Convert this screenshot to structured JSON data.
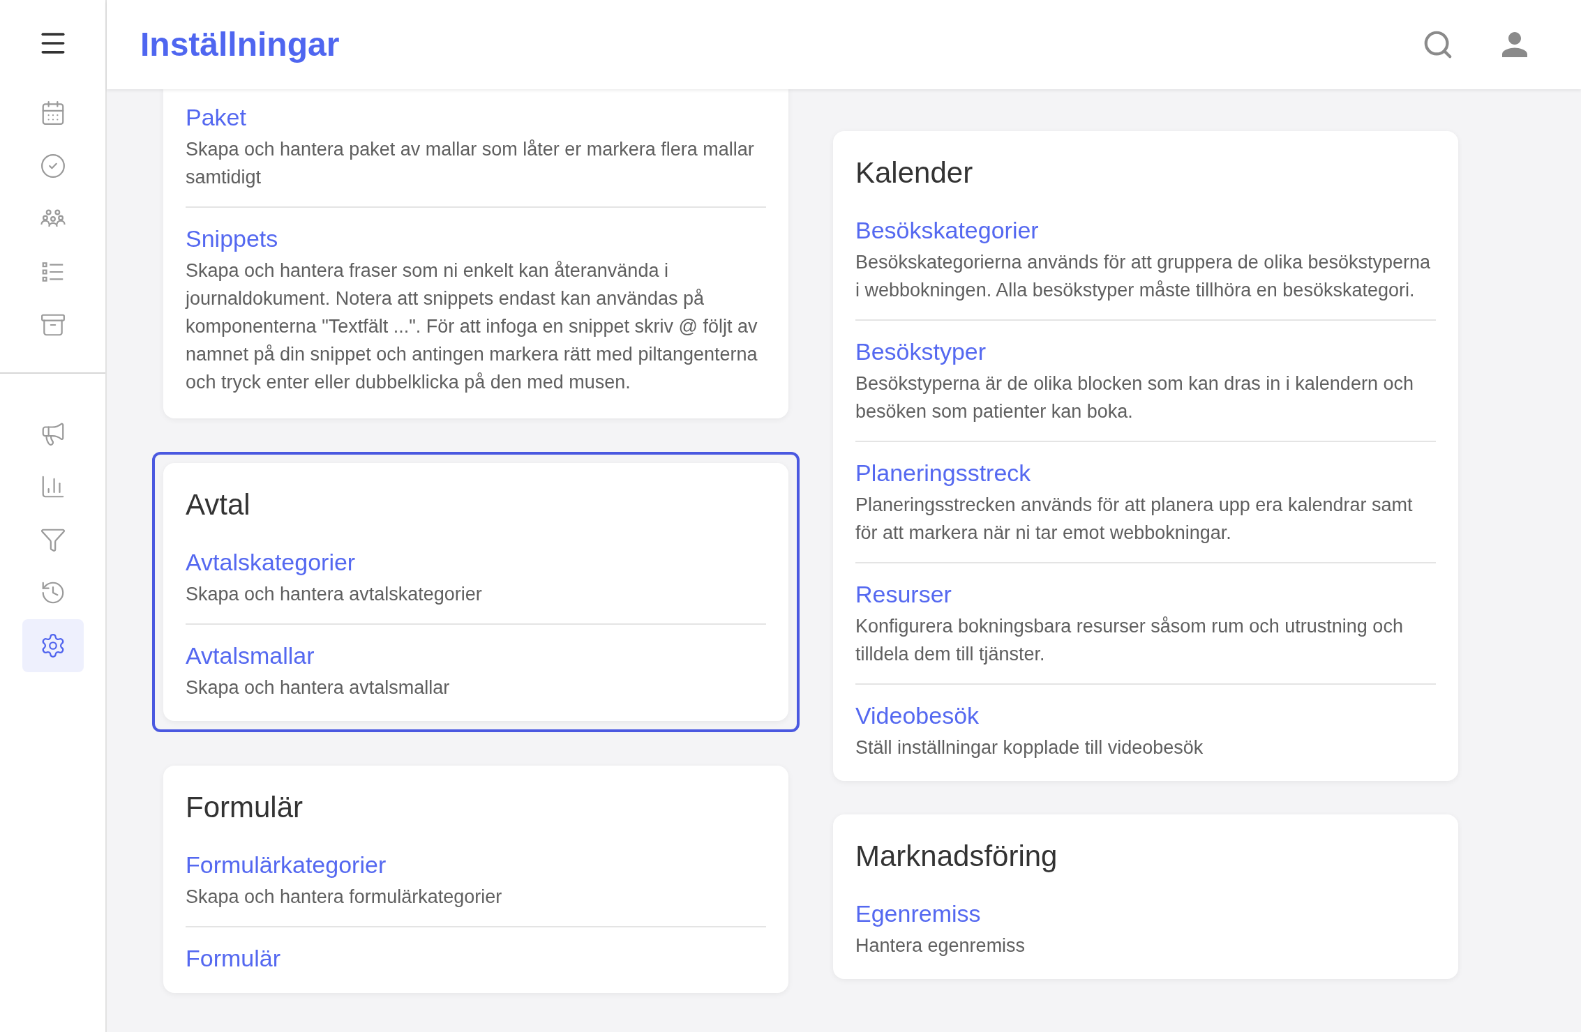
{
  "header": {
    "title": "Inställningar"
  },
  "sidebar": {
    "top_items": [
      {
        "selected": false
      },
      {
        "selected": false
      },
      {
        "selected": false
      },
      {
        "selected": false
      },
      {
        "selected": false
      }
    ],
    "bottom_items": [
      {
        "selected": false
      },
      {
        "selected": false
      },
      {
        "selected": false
      },
      {
        "selected": false
      },
      {
        "selected": true
      }
    ]
  },
  "columns": [
    {
      "cards": [
        {
          "highlighted": false,
          "items": [
            {
              "title": "Paket",
              "description": "Skapa och hantera paket av mallar som låter er markera flera mallar samtidigt"
            },
            {
              "title": "Snippets",
              "description": "Skapa och hantera fraser som ni enkelt kan återanvända i journaldokument. Notera att snippets endast kan användas på komponenterna \"Textfält ...\". För att infoga en snippet skriv @ följt av namnet på din snippet och antingen markera rätt med piltangenterna och tryck enter eller dubbelklicka på den med musen."
            }
          ]
        },
        {
          "title": "Avtal",
          "highlighted": true,
          "items": [
            {
              "title": "Avtalskategorier",
              "description": "Skapa och hantera avtalskategorier"
            },
            {
              "title": "Avtalsmallar",
              "description": "Skapa och hantera avtalsmallar"
            }
          ]
        },
        {
          "title": "Formulär",
          "highlighted": false,
          "items": [
            {
              "title": "Formulärkategorier",
              "description": "Skapa och hantera formulärkategorier"
            },
            {
              "title": "Formulär"
            }
          ]
        }
      ]
    },
    {
      "cards": [
        {
          "title": "Kalender",
          "highlighted": false,
          "items": [
            {
              "title": "Besökskategorier",
              "description": "Besökskategorierna används för att gruppera de olika besökstyperna i webbokningen. Alla besökstyper måste tillhöra en besökskategori."
            },
            {
              "title": "Besökstyper",
              "description": "Besökstyperna är de olika blocken som kan dras in i kalendern och besöken som patienter kan boka."
            },
            {
              "title": "Planeringsstreck",
              "description": "Planeringsstrecken används för att planera upp era kalendrar samt för att markera när ni tar emot webbokningar."
            },
            {
              "title": "Resurser",
              "description": "Konfigurera bokningsbara resurser såsom rum och utrustning och tilldela dem till tjänster."
            },
            {
              "title": "Videobesök",
              "description": "Ställ inställningar kopplade till videobesök"
            }
          ]
        },
        {
          "title": "Marknadsföring",
          "highlighted": false,
          "items": [
            {
              "title": "Egenremiss",
              "description": "Hantera egenremiss"
            }
          ]
        }
      ]
    }
  ]
}
